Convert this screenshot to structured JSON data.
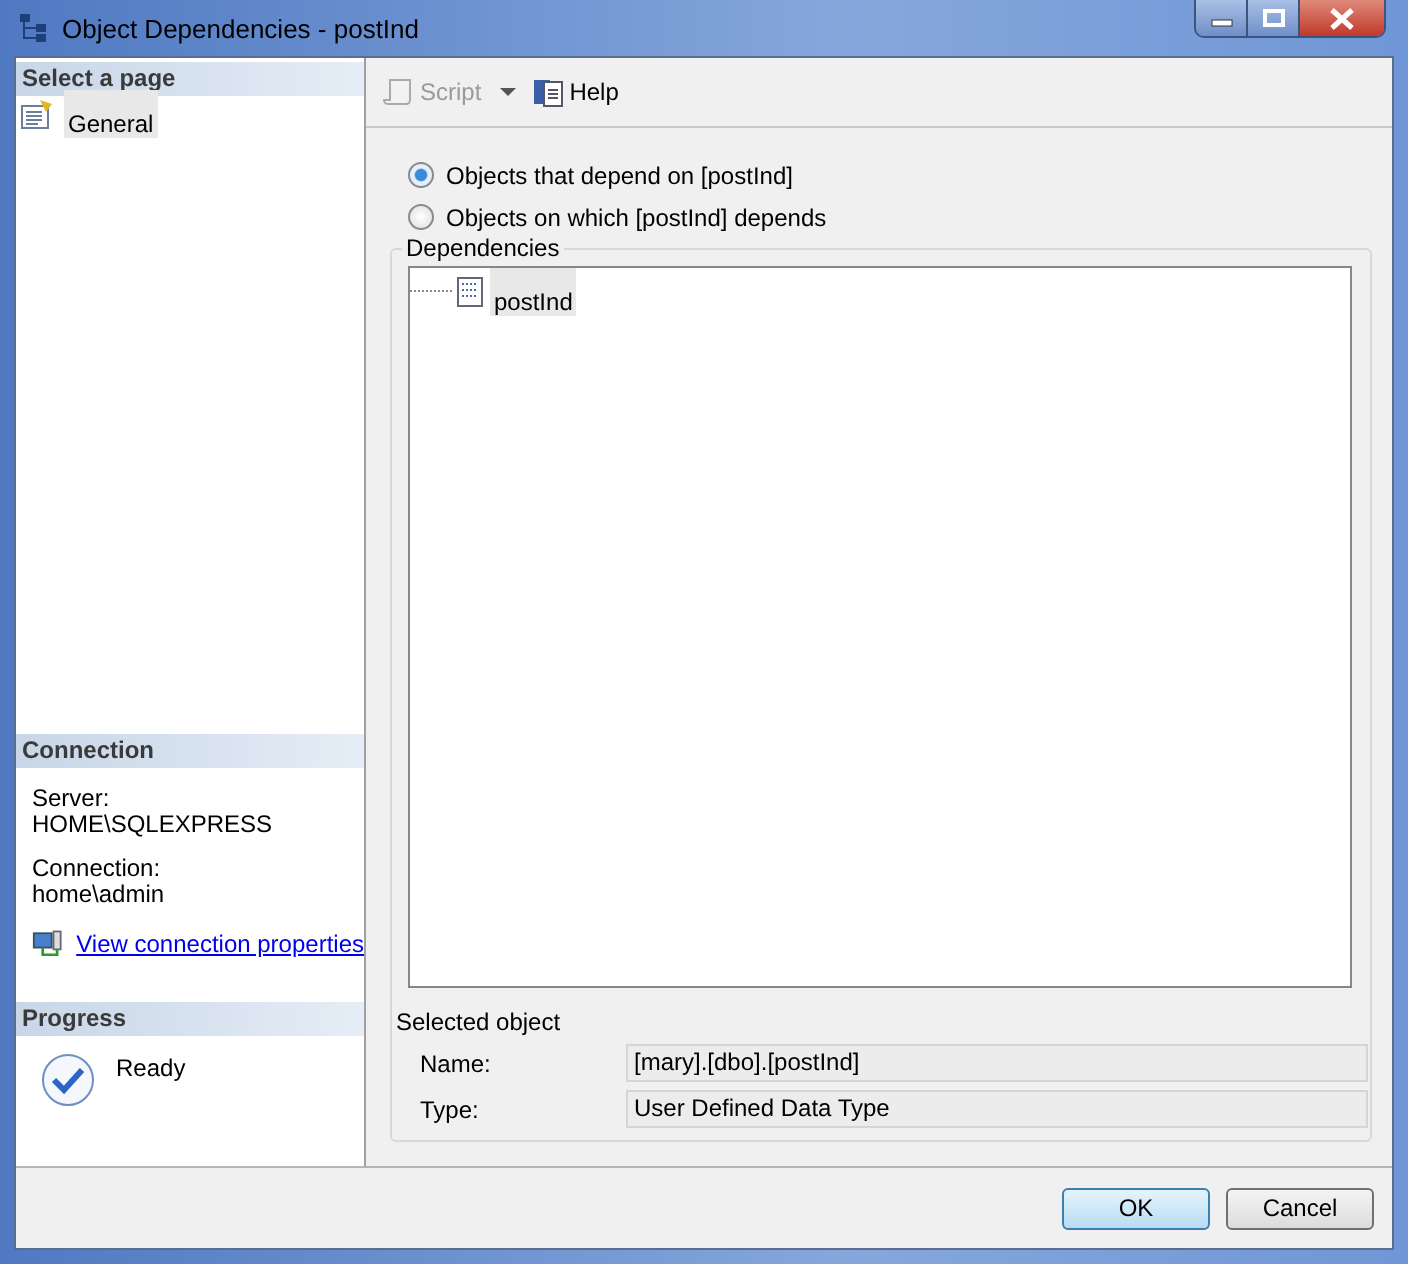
{
  "window": {
    "title": "Object Dependencies - postInd"
  },
  "sidebar": {
    "header": "Select a page",
    "pages": [
      {
        "label": "General",
        "selected": true
      }
    ]
  },
  "connection": {
    "header": "Connection",
    "fields": [
      {
        "label": "Server:",
        "value": "HOME\\SQLEXPRESS"
      },
      {
        "label": "Connection:",
        "value": "home\\admin"
      }
    ],
    "link": "View connection properties"
  },
  "progress": {
    "header": "Progress",
    "status": "Ready"
  },
  "toolbar": {
    "items": [
      {
        "label": "Script",
        "disabled": true,
        "kind": "dropdown"
      },
      {
        "label": "Help",
        "disabled": false,
        "kind": "button"
      }
    ]
  },
  "options": [
    {
      "label": "Objects that depend on [postInd]",
      "selected": true
    },
    {
      "label": "Objects on which [postInd] depends",
      "selected": false
    }
  ],
  "dependencies": {
    "label": "Dependencies",
    "items": [
      {
        "label": "postInd",
        "selected": true
      }
    ]
  },
  "selected_object": {
    "heading": "Selected object",
    "fields": [
      {
        "label": "Name:",
        "value": "[mary].[dbo].[postInd]"
      },
      {
        "label": "Type:",
        "value": "User Defined Data Type"
      }
    ]
  },
  "buttons": [
    {
      "label": "OK",
      "default": true
    },
    {
      "label": "Cancel",
      "default": false
    }
  ]
}
